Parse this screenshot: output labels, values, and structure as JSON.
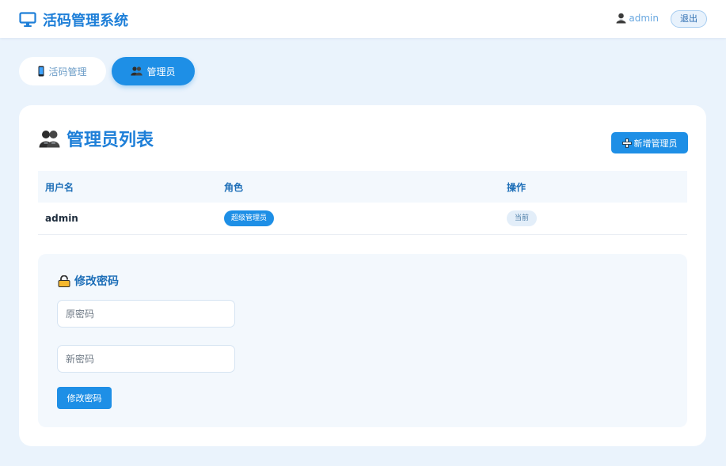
{
  "header": {
    "title": "活码管理系统",
    "user": "admin",
    "logout_label": "退出",
    "brand_color": "#1e7fd8",
    "icons": {
      "brand": "monitor-icon",
      "user": "user-icon"
    }
  },
  "tabs": [
    {
      "label": "活码管理",
      "icon": "phone-icon",
      "active": false
    },
    {
      "label": "管理员",
      "icon": "users-icon",
      "active": true
    }
  ],
  "admins_card": {
    "title": "管理员列表",
    "title_icon": "users-icon",
    "add_button_label": "新增管理员",
    "add_button_icon": "plus-icon",
    "columns": [
      "用户名",
      "角色",
      "操作"
    ],
    "rows": [
      {
        "username": "admin",
        "role": "超级管理员",
        "action": "当前"
      }
    ]
  },
  "password_panel": {
    "title": "修改密码",
    "title_icon": "lock-icon",
    "old_placeholder": "原密码",
    "new_placeholder": "新密码",
    "submit_label": "修改密码"
  },
  "accent_color": "#1e8fe6"
}
